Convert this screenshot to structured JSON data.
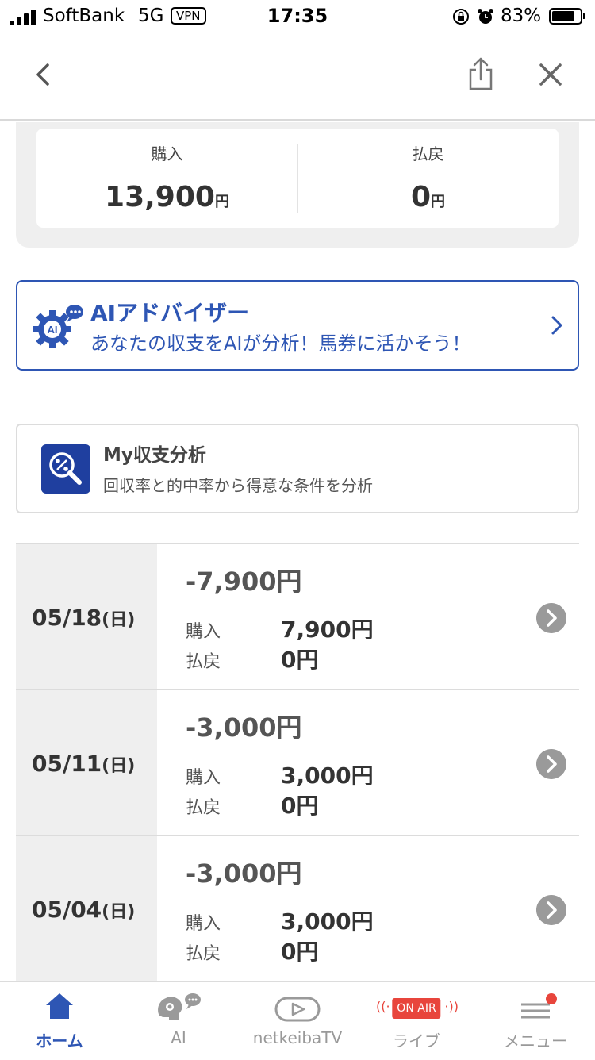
{
  "status_bar": {
    "carrier": "SoftBank",
    "network": "5G",
    "vpn": "VPN",
    "time": "17:35",
    "battery_percent": "83%",
    "battery_level": 0.83
  },
  "summary": {
    "purchase_label": "購入",
    "purchase_value": "13,900",
    "payout_label": "払戻",
    "payout_value": "0",
    "unit": "円"
  },
  "ai_advisor": {
    "title": "AIアドバイザー",
    "subtitle": "あなたの収支をAIが分析！馬券に活かそう！",
    "icon_text": "AI"
  },
  "my_analysis": {
    "title": "My収支分析",
    "subtitle": "回収率と的中率から得意な条件を分析"
  },
  "history": [
    {
      "date": "05/18",
      "dow": "(日)",
      "net": "-7,900円",
      "buy_label": "購入",
      "buy": "7,900円",
      "pay_label": "払戻",
      "pay": "0円"
    },
    {
      "date": "05/11",
      "dow": "(日)",
      "net": "-3,000円",
      "buy_label": "購入",
      "buy": "3,000円",
      "pay_label": "払戻",
      "pay": "0円"
    },
    {
      "date": "05/04",
      "dow": "(日)",
      "net": "-3,000円",
      "buy_label": "購入",
      "buy": "3,000円",
      "pay_label": "払戻",
      "pay": "0円"
    }
  ],
  "tab_bar": {
    "home": "ホーム",
    "ai": "AI",
    "tv": "netkeibaTV",
    "live": "ライブ",
    "live_badge": "ON AIR",
    "menu": "メニュー"
  },
  "colors": {
    "accent": "#2e56b4",
    "icon_bg": "#1f3f9f",
    "onair": "#e8453c",
    "panel_bg": "#efefef"
  }
}
